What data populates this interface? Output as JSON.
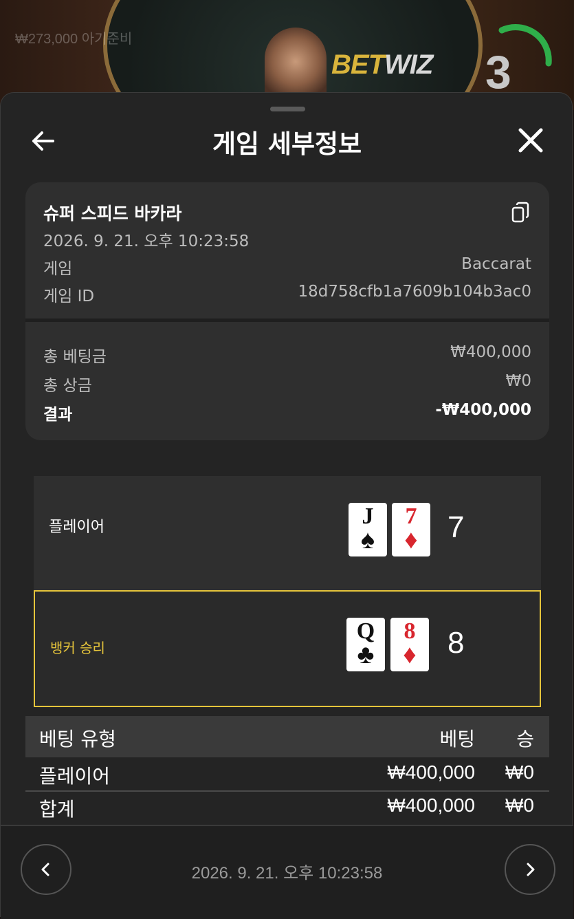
{
  "stream": {
    "balance_text": "₩273,000  아기준비",
    "logo_part1": "BET",
    "logo_part2": "WIZ",
    "timer_value": "3"
  },
  "sheet": {
    "title": "게임 세부정보",
    "back_icon": "arrow-left-icon",
    "close_icon": "close-icon"
  },
  "details": {
    "game_name": "슈퍼 스피드 바카라",
    "datetime": "2026. 9. 21. 오후 10:23:58",
    "rows": [
      {
        "label": "게임",
        "value": "Baccarat"
      },
      {
        "label": "게임 ID",
        "value": "18d758cfb1a7609b104b3ac0"
      }
    ],
    "summary": [
      {
        "label": "총 베팅금",
        "value": "₩400,000"
      },
      {
        "label": "총 상금",
        "value": "₩0"
      },
      {
        "label": "결과",
        "value": "-₩400,000"
      }
    ]
  },
  "rounds": {
    "player": {
      "label": "플레이어",
      "cards": [
        {
          "rank": "J",
          "suit": "♠",
          "color": "black"
        },
        {
          "rank": "7",
          "suit": "♦",
          "color": "red"
        }
      ],
      "score": "7"
    },
    "banker": {
      "label": "뱅커 승리",
      "cards": [
        {
          "rank": "Q",
          "suit": "♣",
          "color": "black"
        },
        {
          "rank": "8",
          "suit": "♦",
          "color": "red"
        }
      ],
      "score": "8"
    }
  },
  "bets_table": {
    "headers": [
      "베팅 유형",
      "베팅",
      "승"
    ],
    "rows": [
      [
        "플레이어",
        "₩400,000",
        "₩0"
      ],
      [
        "합계",
        "₩400,000",
        "₩0"
      ]
    ]
  },
  "footer": {
    "datetime": "2026. 9. 21. 오후 10:23:58",
    "prev_icon": "chevron-left-icon",
    "next_icon": "chevron-right-icon"
  },
  "colors": {
    "accent_gold": "#e6c53b",
    "card_red": "#d8262e",
    "timer_green": "#2fae4a"
  }
}
